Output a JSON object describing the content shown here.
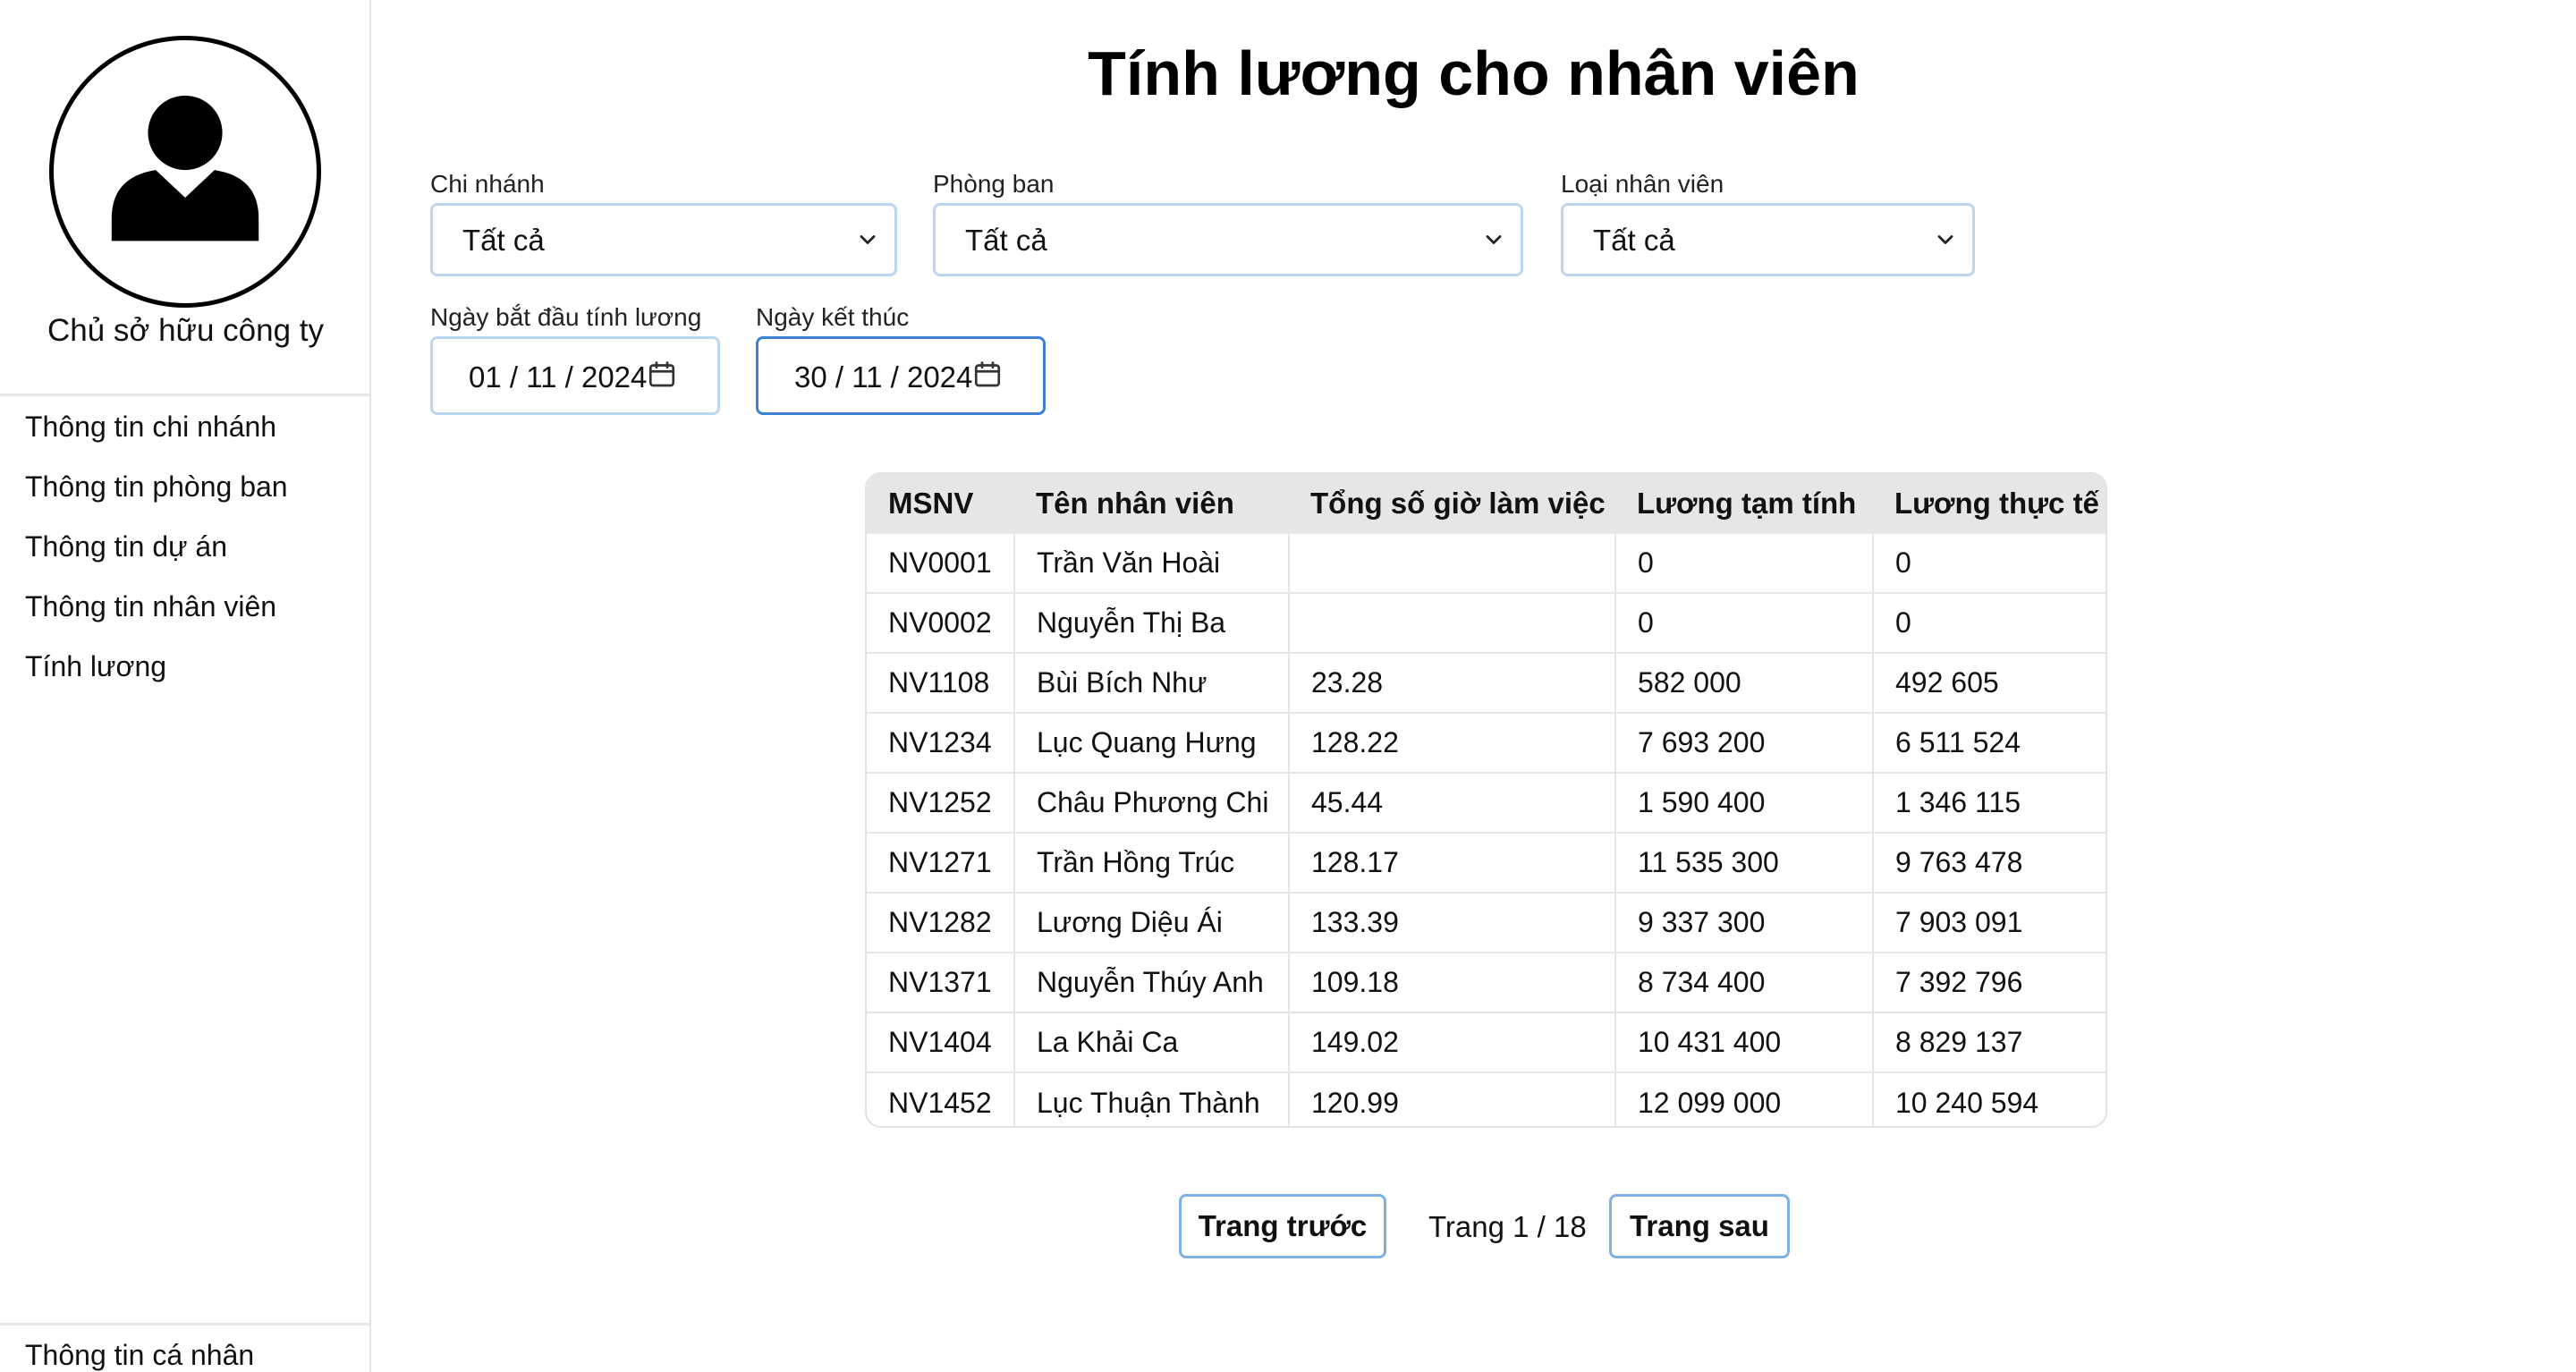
{
  "sidebar": {
    "owner_name": "Chủ sở hữu công ty",
    "nav": [
      {
        "label": "Thông tin chi nhánh"
      },
      {
        "label": "Thông tin phòng ban"
      },
      {
        "label": "Thông tin dự án"
      },
      {
        "label": "Thông tin nhân viên"
      },
      {
        "label": "Tính lương"
      }
    ],
    "profile_label": "Thông tin cá nhân"
  },
  "page": {
    "title": "Tính lương cho nhân viên"
  },
  "filters": {
    "branch": {
      "label": "Chi nhánh",
      "value": "Tất cả"
    },
    "department": {
      "label": "Phòng ban",
      "value": "Tất cả"
    },
    "employee_type": {
      "label": "Loại nhân viên",
      "value": "Tất cả"
    },
    "start_date": {
      "label": "Ngày bắt đầu tính lương",
      "value": "01 / 11 / 2024"
    },
    "end_date": {
      "label": "Ngày kết thúc",
      "value": "30 / 11 / 2024"
    }
  },
  "table": {
    "headers": [
      "MSNV",
      "Tên nhân viên",
      "Tổng số giờ làm việc",
      "Lương tạm tính",
      "Lương thực tế"
    ],
    "rows": [
      [
        "NV0001",
        "Trần Văn Hoài",
        "",
        "0",
        "0"
      ],
      [
        "NV0002",
        "Nguyễn Thị Ba",
        "",
        "0",
        "0"
      ],
      [
        "NV1108",
        "Bùi Bích Như",
        "23.28",
        "582 000",
        "492 605"
      ],
      [
        "NV1234",
        "Lục Quang Hưng",
        "128.22",
        "7 693 200",
        "6 511 524"
      ],
      [
        "NV1252",
        "Châu Phương Chi",
        "45.44",
        "1 590 400",
        "1 346 115"
      ],
      [
        "NV1271",
        "Trần Hồng Trúc",
        "128.17",
        "11 535 300",
        "9 763 478"
      ],
      [
        "NV1282",
        "Lương Diệu Ái",
        "133.39",
        "9 337 300",
        "7 903 091"
      ],
      [
        "NV1371",
        "Nguyễn Thúy Anh",
        "109.18",
        "8 734 400",
        "7 392 796"
      ],
      [
        "NV1404",
        "La Khải Ca",
        "149.02",
        "10 431 400",
        "8 829 137"
      ],
      [
        "NV1452",
        "Lục Thuận Thành",
        "120.99",
        "12 099 000",
        "10 240 594"
      ]
    ]
  },
  "pagination": {
    "prev_label": "Trang trước",
    "page_info": "Trang 1 / 18",
    "next_label": "Trang sau"
  },
  "colors": {
    "input_border": "#bcd6f0",
    "input_border_active": "#3d7ed6",
    "button_border": "#7fb0e6",
    "table_header_bg": "#e6e6e6"
  },
  "icons": [
    "user-avatar-icon",
    "chevron-down-icon",
    "calendar-icon"
  ]
}
